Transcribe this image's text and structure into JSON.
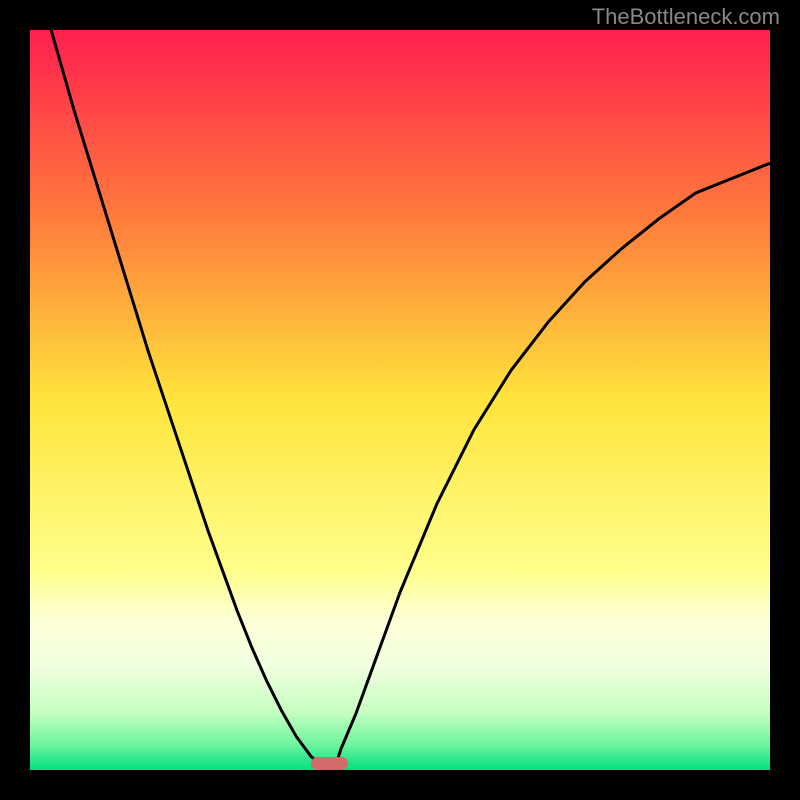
{
  "watermark": "TheBottleneck.com",
  "chart_data": {
    "type": "line",
    "title": "",
    "xlabel": "",
    "ylabel": "",
    "x": [
      0.0,
      0.02,
      0.04,
      0.06,
      0.08,
      0.1,
      0.12,
      0.14,
      0.16,
      0.18,
      0.2,
      0.22,
      0.24,
      0.26,
      0.28,
      0.3,
      0.32,
      0.34,
      0.36,
      0.38,
      0.4,
      0.405,
      0.41,
      0.415,
      0.42,
      0.44,
      0.46,
      0.48,
      0.5,
      0.55,
      0.6,
      0.65,
      0.7,
      0.75,
      0.8,
      0.85,
      0.9,
      0.95,
      1.0
    ],
    "values": [
      1.1,
      1.03,
      0.96,
      0.89,
      0.825,
      0.76,
      0.695,
      0.63,
      0.565,
      0.505,
      0.445,
      0.385,
      0.325,
      0.27,
      0.215,
      0.165,
      0.12,
      0.08,
      0.045,
      0.018,
      0.003,
      0.0,
      0.003,
      0.012,
      0.028,
      0.075,
      0.13,
      0.185,
      0.24,
      0.36,
      0.46,
      0.54,
      0.605,
      0.66,
      0.705,
      0.745,
      0.78,
      0.8,
      0.82
    ],
    "xlim": [
      0,
      1
    ],
    "ylim": [
      0,
      1
    ],
    "minimum_x": 0.405,
    "marker": {
      "x": 0.405,
      "width": 0.05,
      "height": 0.018
    },
    "gradient_stops": [
      {
        "offset": 0.0,
        "color": "#ff1f4f"
      },
      {
        "offset": 0.25,
        "color": "#ff7a3c"
      },
      {
        "offset": 0.5,
        "color": "#ffe43c"
      },
      {
        "offset": 0.73,
        "color": "#ffff8c"
      },
      {
        "offset": 0.8,
        "color": "#fdffd8"
      },
      {
        "offset": 0.86,
        "color": "#f0ffe0"
      },
      {
        "offset": 0.92,
        "color": "#c8ffc0"
      },
      {
        "offset": 0.965,
        "color": "#70f5a0"
      },
      {
        "offset": 1.0,
        "color": "#00e080"
      }
    ]
  },
  "colors": {
    "curve": "#000000",
    "border": "#000000",
    "marker": "#d46a6a"
  }
}
